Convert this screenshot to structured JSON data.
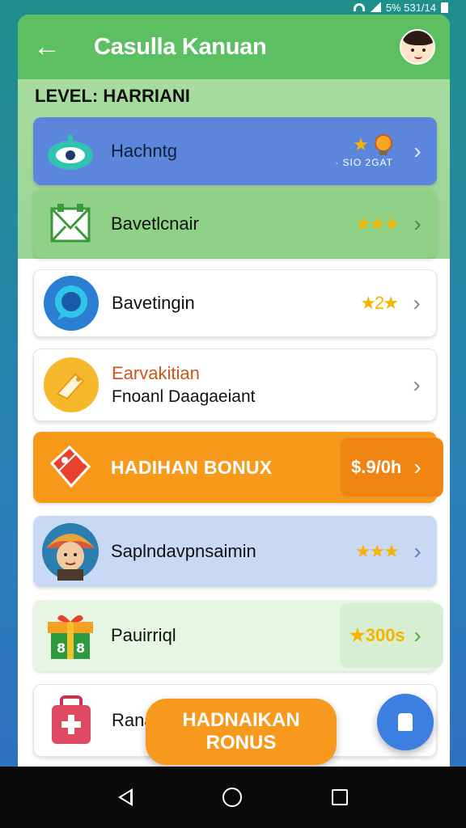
{
  "status": {
    "text": "5%  531/14"
  },
  "header": {
    "title": "Casulla Kanuan",
    "back_icon": "arrow-left-icon"
  },
  "level": "LEVEL: HARRIANI",
  "rows": [
    {
      "label": "Hachntg",
      "stars": "★",
      "sub": "· SIO 2GAT"
    },
    {
      "label": "Bavetlcnair",
      "stars": "★★★"
    },
    {
      "label": "Bavetingin",
      "stars": "★2★"
    },
    {
      "label1": "Earvakitian",
      "label2": "Fnoanl Daagaeiant"
    },
    {
      "label": "HADIHAN BONUX",
      "amount": "$.9/0h"
    },
    {
      "label": "Saplndavpnsaimin",
      "stars": "★★★"
    },
    {
      "label": "Pauirriql",
      "amount": "★300s"
    },
    {
      "label": "Ranā"
    }
  ],
  "bonus_button": "HADNAIKAN RONUS",
  "colors": {
    "accent_green": "#5cbf62",
    "blue": "#5b86dc",
    "orange": "#f79a1c"
  }
}
